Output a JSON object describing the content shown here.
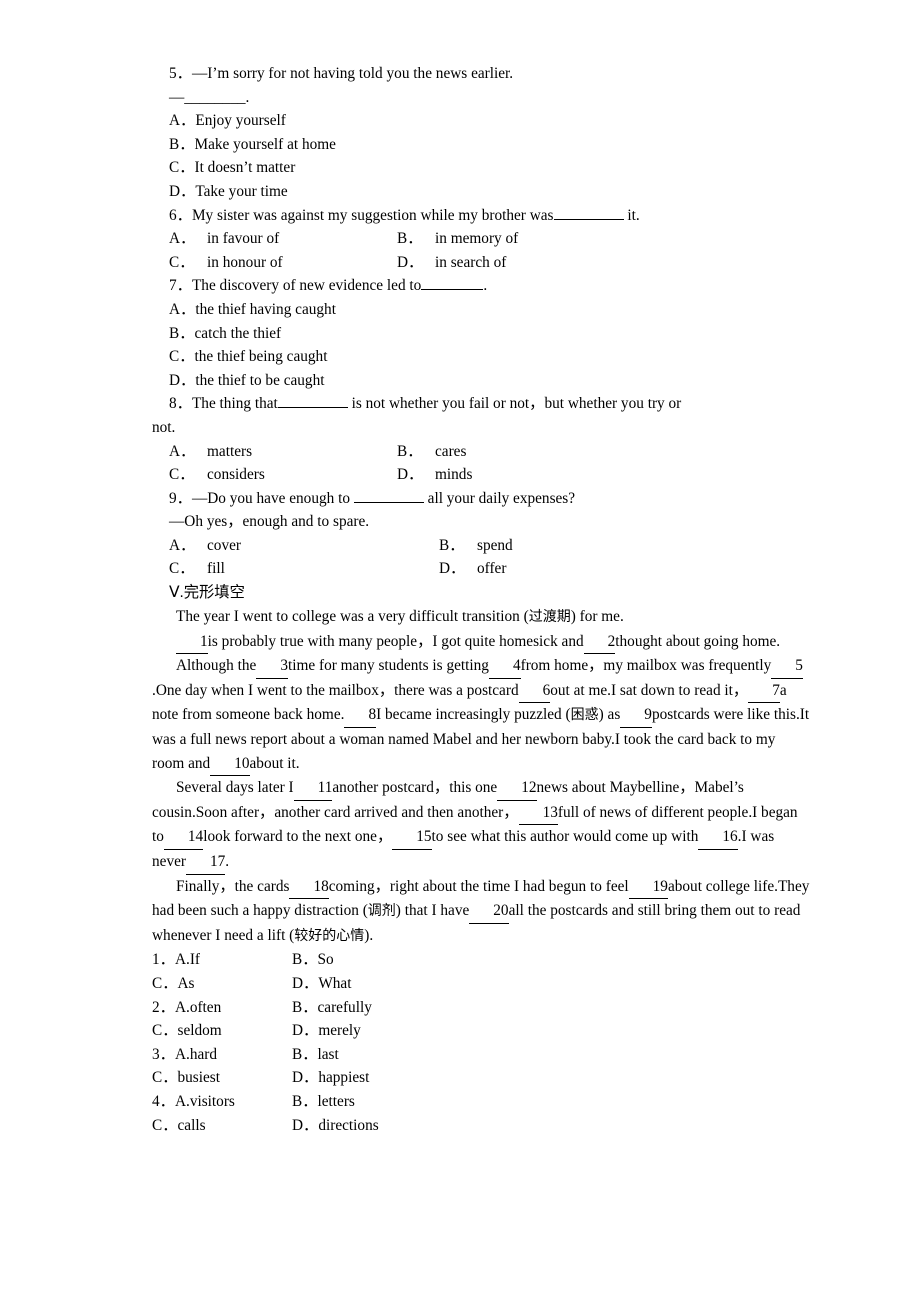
{
  "questions": [
    {
      "num": "5",
      "stem_lines": [
        "5．—I’m sorry for not having told you the news earlier.",
        "—________."
      ],
      "options_single": [
        "A．Enjoy yourself",
        "B．Make yourself at home",
        "C．It doesn’t matter",
        "D．Take your time"
      ]
    },
    {
      "num": "6",
      "stem_pre": "6．My sister was against my suggestion while my brother was",
      "stem_post": "it.",
      "options_grid": [
        {
          "a_label": "A．",
          "a_text": "in favour of",
          "b_label": "B．",
          "b_text": "in memory of"
        },
        {
          "a_label": "C．",
          "a_text": "in honour of",
          "b_label": "D．",
          "b_text": "in search of"
        }
      ]
    },
    {
      "num": "7",
      "stem_pre": "7．The discovery of new evidence led to",
      "stem_post": ".",
      "options_single": [
        "A．the thief having caught",
        "B．catch the thief",
        "C．the thief being caught",
        "D．the thief to be caught"
      ]
    },
    {
      "num": "8",
      "stem_pre": "8．The thing that",
      "stem_mid": "is not whether you fail or not，but whether you try or",
      "stem_wrap": "not.",
      "options_grid": [
        {
          "a_label": "A．",
          "a_text": "matters",
          "b_label": "B．",
          "b_text": "cares"
        },
        {
          "a_label": "C．",
          "a_text": "considers",
          "b_label": "D．",
          "b_text": "minds"
        }
      ]
    },
    {
      "num": "9",
      "stem_pre": "9．—Do you have enough to",
      "stem_post": "all your daily expenses?",
      "stem_reply": "—Oh yes，enough and to spare.",
      "options_grid": [
        {
          "a_label": "A．",
          "a_text": "cover",
          "b_label": "B．",
          "b_text": "spend"
        },
        {
          "a_label": "C．",
          "a_text": "fill",
          "b_label": "D．",
          "b_text": "offer"
        }
      ]
    }
  ],
  "section": {
    "label": "Ⅴ.完形填空"
  },
  "cloze": {
    "paragraphs": [
      {
        "segments": [
          {
            "t": "text",
            "v": "The year I went to college was a very difficult transition ("
          },
          {
            "t": "cn",
            "v": "过渡期"
          },
          {
            "t": "text",
            "v": ") for me."
          }
        ]
      },
      {
        "segments": [
          {
            "t": "blank",
            "v": "1"
          },
          {
            "t": "text",
            "v": "is probably true with many people，I got quite homesick and"
          },
          {
            "t": "blank",
            "v": "2"
          },
          {
            "t": "text",
            "v": "thought about going home."
          }
        ]
      },
      {
        "segments": [
          {
            "t": "text",
            "v": "Although the"
          },
          {
            "t": "blank",
            "v": "3"
          },
          {
            "t": "text",
            "v": "time for many students is getting"
          },
          {
            "t": "blank",
            "v": "4"
          },
          {
            "t": "text",
            "v": "from home，my mailbox was frequently"
          },
          {
            "t": "blank",
            "v": "5"
          },
          {
            "t": "text",
            "v": ".One day when I went to the mailbox，there was a postcard"
          },
          {
            "t": "blank",
            "v": "6"
          },
          {
            "t": "text",
            "v": "out at me.I sat down to read it，"
          },
          {
            "t": "blank",
            "v": "7"
          },
          {
            "t": "text",
            "v": "a note from someone back home."
          },
          {
            "t": "blank",
            "v": "8"
          },
          {
            "t": "text",
            "v": "I became increasingly puzzled ("
          },
          {
            "t": "cn",
            "v": "困惑"
          },
          {
            "t": "text",
            "v": ") as"
          },
          {
            "t": "blank",
            "v": "9"
          },
          {
            "t": "text",
            "v": "postcards were like this.It was a full news report about a woman named Mabel and her newborn baby.I took the card back to my room and"
          },
          {
            "t": "blank",
            "v": "10"
          },
          {
            "t": "text",
            "v": "about it."
          }
        ]
      },
      {
        "segments": [
          {
            "t": "text",
            "v": "Several days later I"
          },
          {
            "t": "blank",
            "v": "11"
          },
          {
            "t": "text",
            "v": "another postcard，this one"
          },
          {
            "t": "blank",
            "v": "12"
          },
          {
            "t": "text",
            "v": "news about Maybelline，Mabel’s cousin.Soon after，another card arrived and then another，"
          },
          {
            "t": "blank",
            "v": "13"
          },
          {
            "t": "text",
            "v": "full of news of different people.I began to"
          },
          {
            "t": "blank",
            "v": "14"
          },
          {
            "t": "text",
            "v": "look forward to the next one，"
          },
          {
            "t": "blank",
            "v": "15"
          },
          {
            "t": "text",
            "v": "to see what this author would come up with"
          },
          {
            "t": "blank",
            "v": "16"
          },
          {
            "t": "text",
            "v": ".I was never"
          },
          {
            "t": "blank",
            "v": "17"
          },
          {
            "t": "text",
            "v": "."
          }
        ]
      },
      {
        "segments": [
          {
            "t": "text",
            "v": "Finally，the cards"
          },
          {
            "t": "blank",
            "v": "18"
          },
          {
            "t": "text",
            "v": "coming，right about the time I had begun to feel"
          },
          {
            "t": "blank",
            "v": "19"
          },
          {
            "t": "text",
            "v": "about college life.They had been such a happy distraction ("
          },
          {
            "t": "cn",
            "v": "调剂"
          },
          {
            "t": "text",
            "v": ") that I have"
          },
          {
            "t": "blank",
            "v": "20"
          },
          {
            "t": "text",
            "v": "all the postcards and still bring them out to read whenever I need a lift ("
          },
          {
            "t": "cn",
            "v": "较好的心情"
          },
          {
            "t": "text",
            "v": ")."
          }
        ]
      }
    ],
    "answer_rows": [
      {
        "a_label": "1．A.If",
        "b_label": "B．So",
        "c_label": "C．As",
        "d_label": "D．What"
      },
      {
        "a_label": "2．A.often",
        "b_label": "B．carefully",
        "c_label": "C．seldom",
        "d_label": "D．merely"
      },
      {
        "a_label": "3．A.hard",
        "b_label": "B．last",
        "c_label": "C．busiest",
        "d_label": "D．happiest"
      },
      {
        "a_label": "4．A.visitors",
        "b_label": "B．letters",
        "c_label": "C．calls",
        "d_label": "D．directions"
      }
    ]
  }
}
